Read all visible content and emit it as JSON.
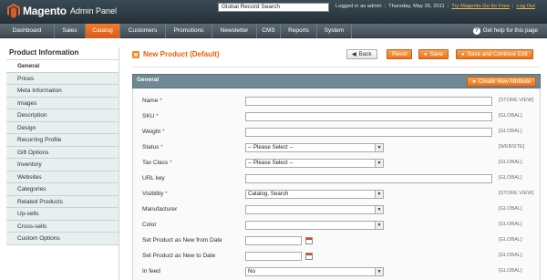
{
  "header": {
    "logo_text": "Magento",
    "logo_sub": "Admin Panel",
    "search_value": "Global Record Search",
    "logged_in": "Logged in as admin",
    "date": "Thursday, May 26, 2011",
    "try_link": "Try Magento Go for Free",
    "logout": "Log Out"
  },
  "nav": {
    "items": [
      "Dashboard",
      "Sales",
      "Catalog",
      "Customers",
      "Promotions",
      "Newsletter",
      "CMS",
      "Reports",
      "System"
    ],
    "active": "Catalog",
    "help": "Get help for this page"
  },
  "sidebar": {
    "title": "Product Information",
    "items": [
      "General",
      "Prices",
      "Meta Information",
      "Images",
      "Description",
      "Design",
      "Recurring Profile",
      "Gift Options",
      "Inventory",
      "Websites",
      "Categories",
      "Related Products",
      "Up-sells",
      "Cross-sells",
      "Custom Options"
    ],
    "active": "General"
  },
  "page": {
    "title": "New Product (Default)",
    "buttons": {
      "back": "Back",
      "reset": "Reset",
      "save": "Save",
      "save_continue": "Save and Continue Edit"
    }
  },
  "section": {
    "title": "General",
    "add_attribute": "Create New Attribute"
  },
  "fields": [
    {
      "label": "Name",
      "required": "*",
      "type": "text",
      "value": "",
      "scope": "[STORE VIEW]"
    },
    {
      "label": "SKU",
      "required": "*",
      "type": "text",
      "value": "",
      "scope": "[GLOBAL]"
    },
    {
      "label": "Weight",
      "required": "*",
      "type": "text",
      "value": "",
      "scope": "[GLOBAL]"
    },
    {
      "label": "Status",
      "required": "*",
      "type": "select",
      "value": "-- Please Select --",
      "scope": "[WEBSITE]"
    },
    {
      "label": "Tax Class",
      "required": "*",
      "type": "select",
      "value": "-- Please Select --",
      "scope": "[GLOBAL]"
    },
    {
      "label": "URL key",
      "required": "",
      "type": "text",
      "value": "",
      "scope": "[GLOBAL]"
    },
    {
      "label": "Visibility",
      "required": "*",
      "type": "select",
      "value": "Catalog, Search",
      "scope": "[STORE VIEW]"
    },
    {
      "label": "Manufacturer",
      "required": "",
      "type": "select",
      "value": "",
      "scope": "[GLOBAL]"
    },
    {
      "label": "Color",
      "required": "",
      "type": "select",
      "value": "",
      "scope": "[GLOBAL]"
    },
    {
      "label": "Set Product as New from Date",
      "required": "",
      "type": "date",
      "value": "",
      "scope": "[GLOBAL]"
    },
    {
      "label": "Set Product as New to Date",
      "required": "",
      "type": "date",
      "value": "",
      "scope": "[GLOBAL]"
    },
    {
      "label": "In feed",
      "required": "",
      "type": "select",
      "value": "No",
      "scope": "[GLOBAL]"
    }
  ],
  "colors": {
    "accent": "#eb5e00",
    "header_bg": "#2f3b43",
    "nav_bg": "#4d5b64",
    "sidebar_bg": "#e7efef",
    "section_bg": "#6f8992"
  }
}
